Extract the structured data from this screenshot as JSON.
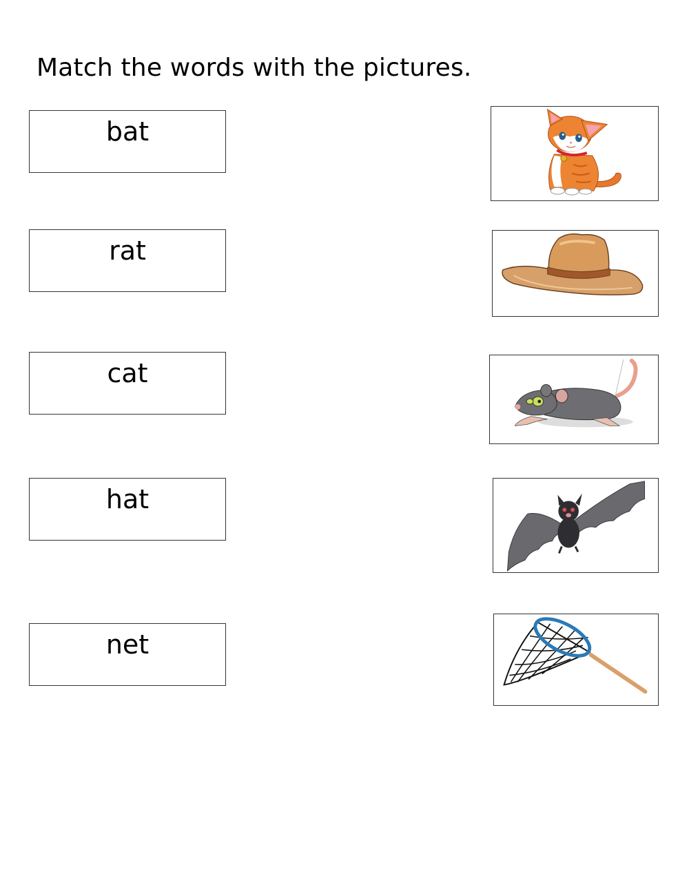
{
  "worksheet": {
    "title": "Match the words with the pictures.",
    "words": [
      {
        "label": "bat"
      },
      {
        "label": "rat"
      },
      {
        "label": "cat"
      },
      {
        "label": "hat"
      },
      {
        "label": "net"
      }
    ],
    "pictures": [
      {
        "subject": "cat",
        "icon": "cat-icon"
      },
      {
        "subject": "hat",
        "icon": "hat-icon"
      },
      {
        "subject": "rat",
        "icon": "rat-icon"
      },
      {
        "subject": "bat",
        "icon": "bat-icon"
      },
      {
        "subject": "net",
        "icon": "net-icon"
      }
    ]
  }
}
